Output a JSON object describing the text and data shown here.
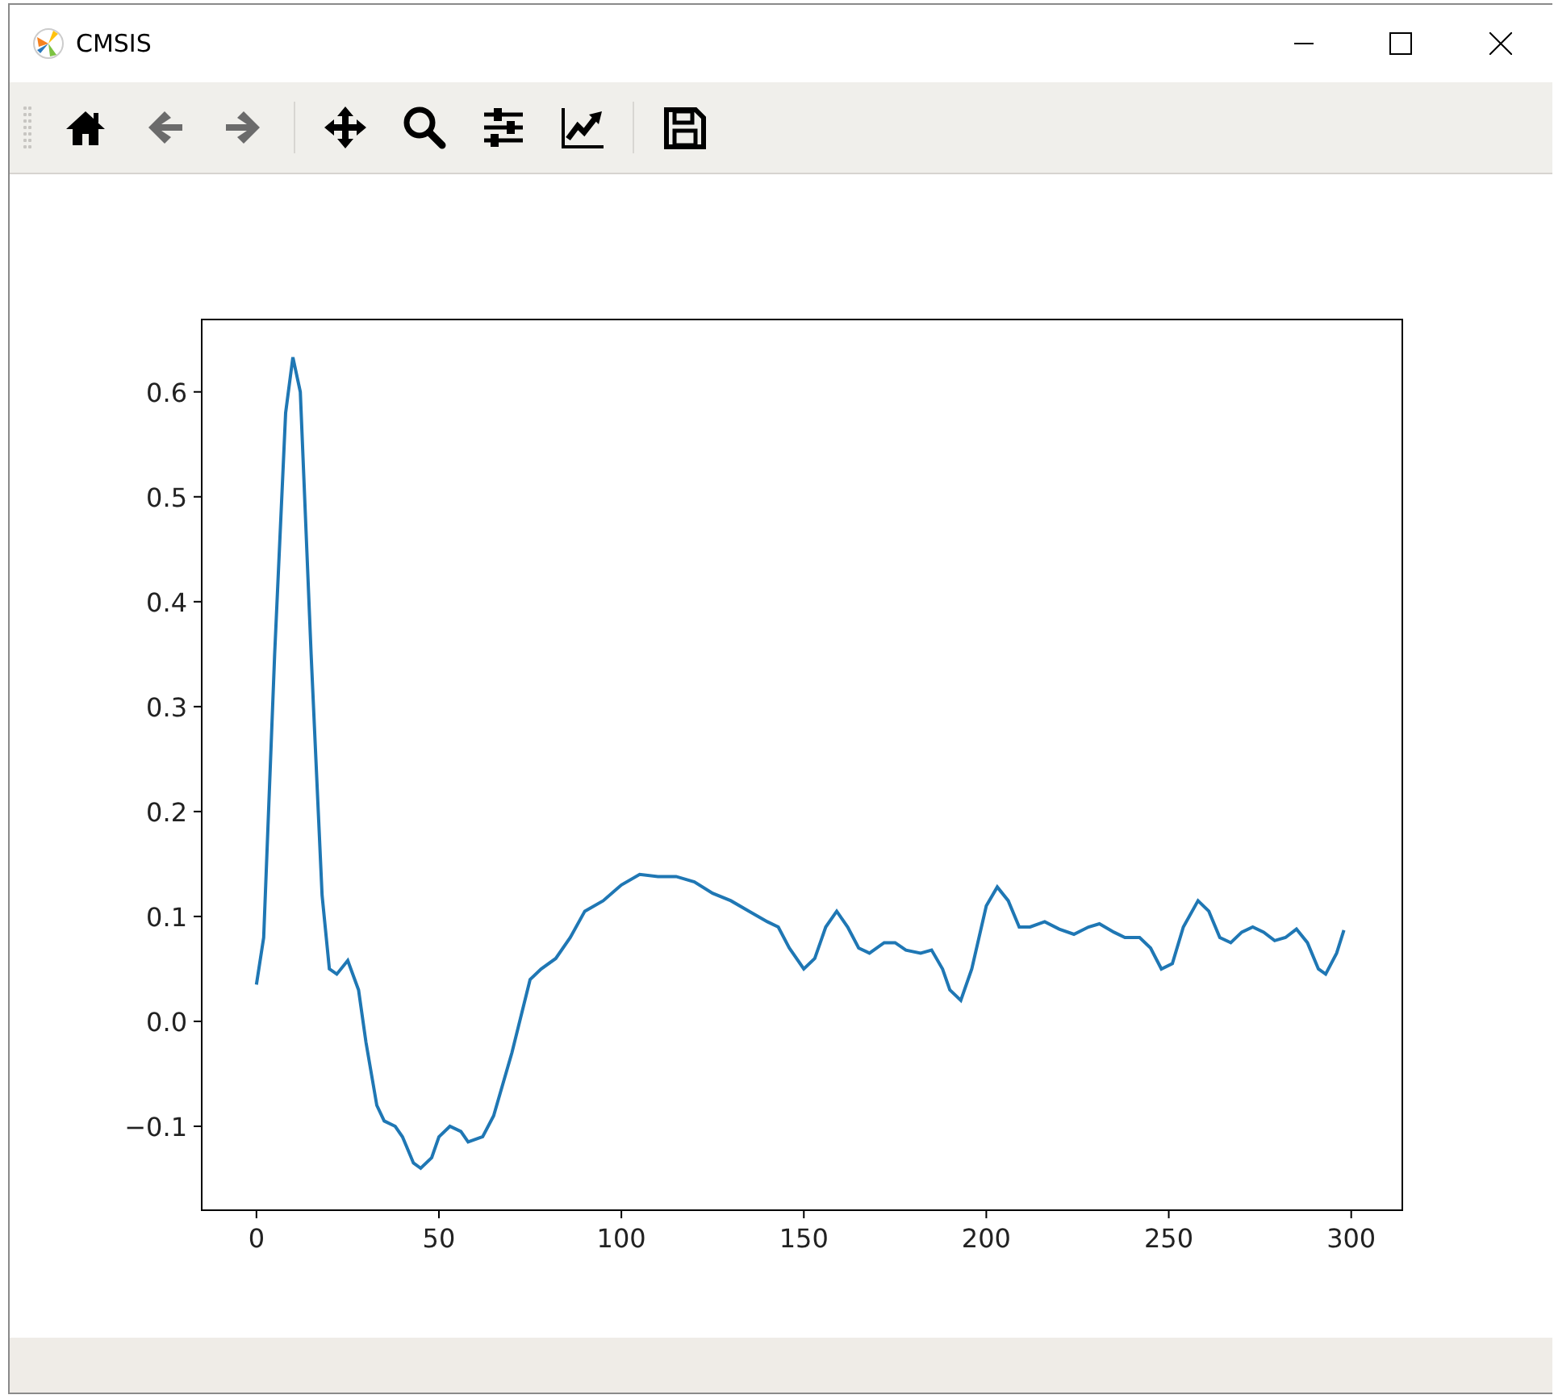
{
  "window": {
    "title": "CMSIS"
  },
  "toolbar": {
    "buttons": [
      {
        "kind": "home",
        "disabled": false
      },
      {
        "kind": "back",
        "disabled": true
      },
      {
        "kind": "forward",
        "disabled": true
      },
      {
        "kind": "separator"
      },
      {
        "kind": "pan",
        "disabled": false
      },
      {
        "kind": "zoom",
        "disabled": false
      },
      {
        "kind": "configure",
        "disabled": false
      },
      {
        "kind": "edit",
        "disabled": false
      },
      {
        "kind": "separator"
      },
      {
        "kind": "save",
        "disabled": false
      }
    ]
  },
  "figure": {
    "chart_data": {
      "type": "line",
      "xlim": [
        -15,
        314
      ],
      "ylim": [
        -0.18,
        0.669
      ],
      "xticks": [
        {
          "value": 0,
          "label": "0"
        },
        {
          "value": 50,
          "label": "50"
        },
        {
          "value": 100,
          "label": "100"
        },
        {
          "value": 150,
          "label": "150"
        },
        {
          "value": 200,
          "label": "200"
        },
        {
          "value": 250,
          "label": "250"
        },
        {
          "value": 300,
          "label": "300"
        }
      ],
      "yticks": [
        {
          "value": -0.1,
          "label": "−0.1"
        },
        {
          "value": 0,
          "label": "0.0"
        },
        {
          "value": 0.1,
          "label": "0.1"
        },
        {
          "value": 0.2,
          "label": "0.2"
        },
        {
          "value": 0.3,
          "label": "0.3"
        },
        {
          "value": 0.4,
          "label": "0.4"
        },
        {
          "value": 0.5,
          "label": "0.5"
        },
        {
          "value": 0.6,
          "label": "0.6"
        }
      ],
      "x": [
        0,
        2,
        5,
        8,
        10,
        12,
        15,
        18,
        20,
        22,
        25,
        28,
        30,
        33,
        35,
        38,
        40,
        43,
        45,
        48,
        50,
        53,
        56,
        58,
        62,
        65,
        70,
        75,
        78,
        82,
        86,
        90,
        95,
        100,
        105,
        110,
        115,
        120,
        125,
        130,
        135,
        140,
        143,
        146,
        150,
        153,
        156,
        159,
        162,
        165,
        168,
        172,
        175,
        178,
        182,
        185,
        188,
        190,
        193,
        196,
        200,
        203,
        206,
        209,
        212,
        216,
        220,
        224,
        228,
        231,
        235,
        238,
        242,
        245,
        248,
        251,
        254,
        258,
        261,
        264,
        267,
        270,
        273,
        276,
        279,
        282,
        285,
        288,
        291,
        293,
        296,
        298
      ],
      "series": [
        {
          "color": "#1f77b4",
          "values": [
            0.035,
            0.08,
            0.35,
            0.58,
            0.633,
            0.6,
            0.35,
            0.12,
            0.05,
            0.045,
            0.058,
            0.03,
            -0.02,
            -0.08,
            -0.095,
            -0.1,
            -0.11,
            -0.135,
            -0.14,
            -0.13,
            -0.11,
            -0.1,
            -0.105,
            -0.115,
            -0.11,
            -0.09,
            -0.03,
            0.04,
            0.05,
            0.06,
            0.08,
            0.105,
            0.115,
            0.13,
            0.14,
            0.138,
            0.138,
            0.133,
            0.122,
            0.115,
            0.105,
            0.095,
            0.09,
            0.07,
            0.05,
            0.06,
            0.09,
            0.105,
            0.09,
            0.07,
            0.065,
            0.075,
            0.075,
            0.068,
            0.065,
            0.068,
            0.05,
            0.03,
            0.02,
            0.05,
            0.11,
            0.128,
            0.115,
            0.09,
            0.09,
            0.095,
            0.088,
            0.083,
            0.09,
            0.093,
            0.085,
            0.08,
            0.08,
            0.07,
            0.05,
            0.055,
            0.09,
            0.115,
            0.105,
            0.08,
            0.075,
            0.085,
            0.09,
            0.085,
            0.077,
            0.08,
            0.088,
            0.075,
            0.05,
            0.045,
            0.065,
            0.087
          ]
        }
      ]
    }
  }
}
